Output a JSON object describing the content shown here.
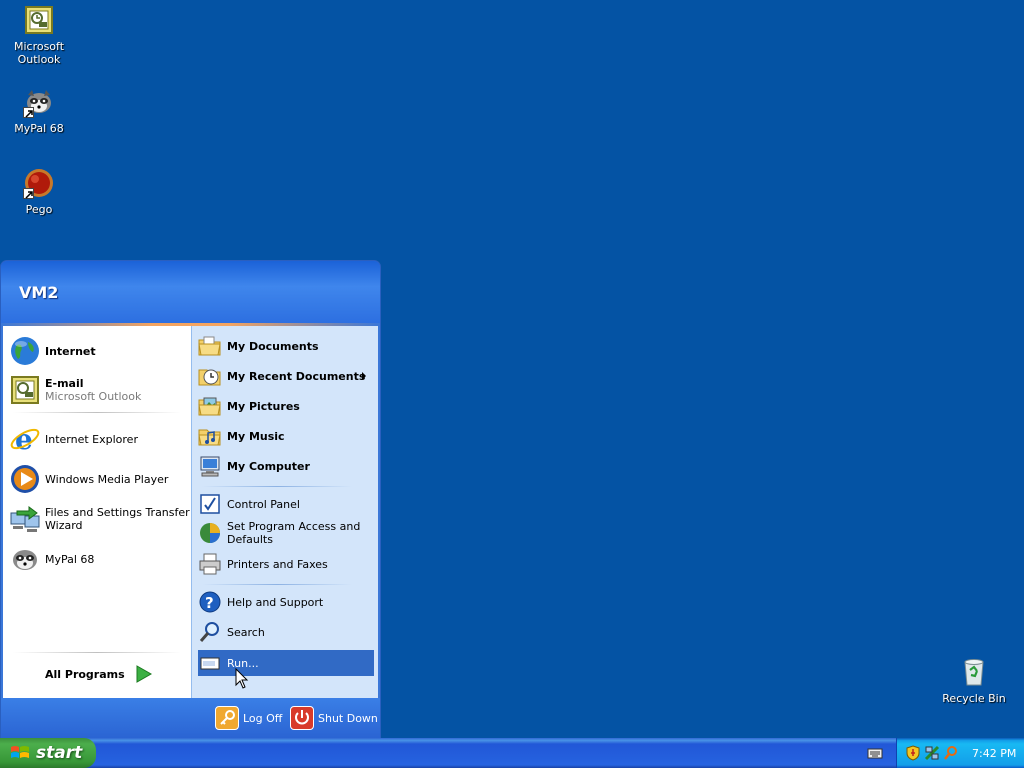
{
  "desktop": {
    "icons": [
      {
        "label_line1": "Microsoft",
        "label_line2": "Outlook",
        "icon": "outlook-icon"
      },
      {
        "label_line1": "MyPal 68",
        "label_line2": "",
        "icon": "mypal-icon"
      },
      {
        "label_line1": "Pego",
        "label_line2": "",
        "icon": "pego-icon"
      },
      {
        "label_line1": "Recycle Bin",
        "label_line2": "",
        "icon": "recycle-bin-icon"
      }
    ]
  },
  "start_menu": {
    "user": "VM2",
    "pinned": [
      {
        "title": "Internet",
        "subtitle": ""
      },
      {
        "title": "E-mail",
        "subtitle": "Microsoft Outlook"
      }
    ],
    "recent": [
      {
        "label": "Internet Explorer"
      },
      {
        "label_line1": "Windows Media Player"
      },
      {
        "label_line1": "Files and Settings Transfer",
        "label_line2": "Wizard"
      },
      {
        "label": "MyPal 68"
      }
    ],
    "all_programs": "All Programs",
    "right": {
      "my_documents": "My Documents",
      "my_recent_documents": "My Recent Documents",
      "my_pictures": "My Pictures",
      "my_music": "My Music",
      "my_computer": "My Computer",
      "control_panel": "Control Panel",
      "set_program_line1": "Set Program Access and",
      "set_program_line2": "Defaults",
      "printers": "Printers and Faxes",
      "help": "Help and Support",
      "search": "Search",
      "run": "Run..."
    },
    "footer": {
      "log_off": "Log Off",
      "shut_down": "Shut Down"
    }
  },
  "taskbar": {
    "start_label": "start",
    "clock": "7:42 PM"
  },
  "colors": {
    "desktop_bg": "#0453a4",
    "highlight": "#316ac5",
    "start_green": "#3c8f3c"
  }
}
